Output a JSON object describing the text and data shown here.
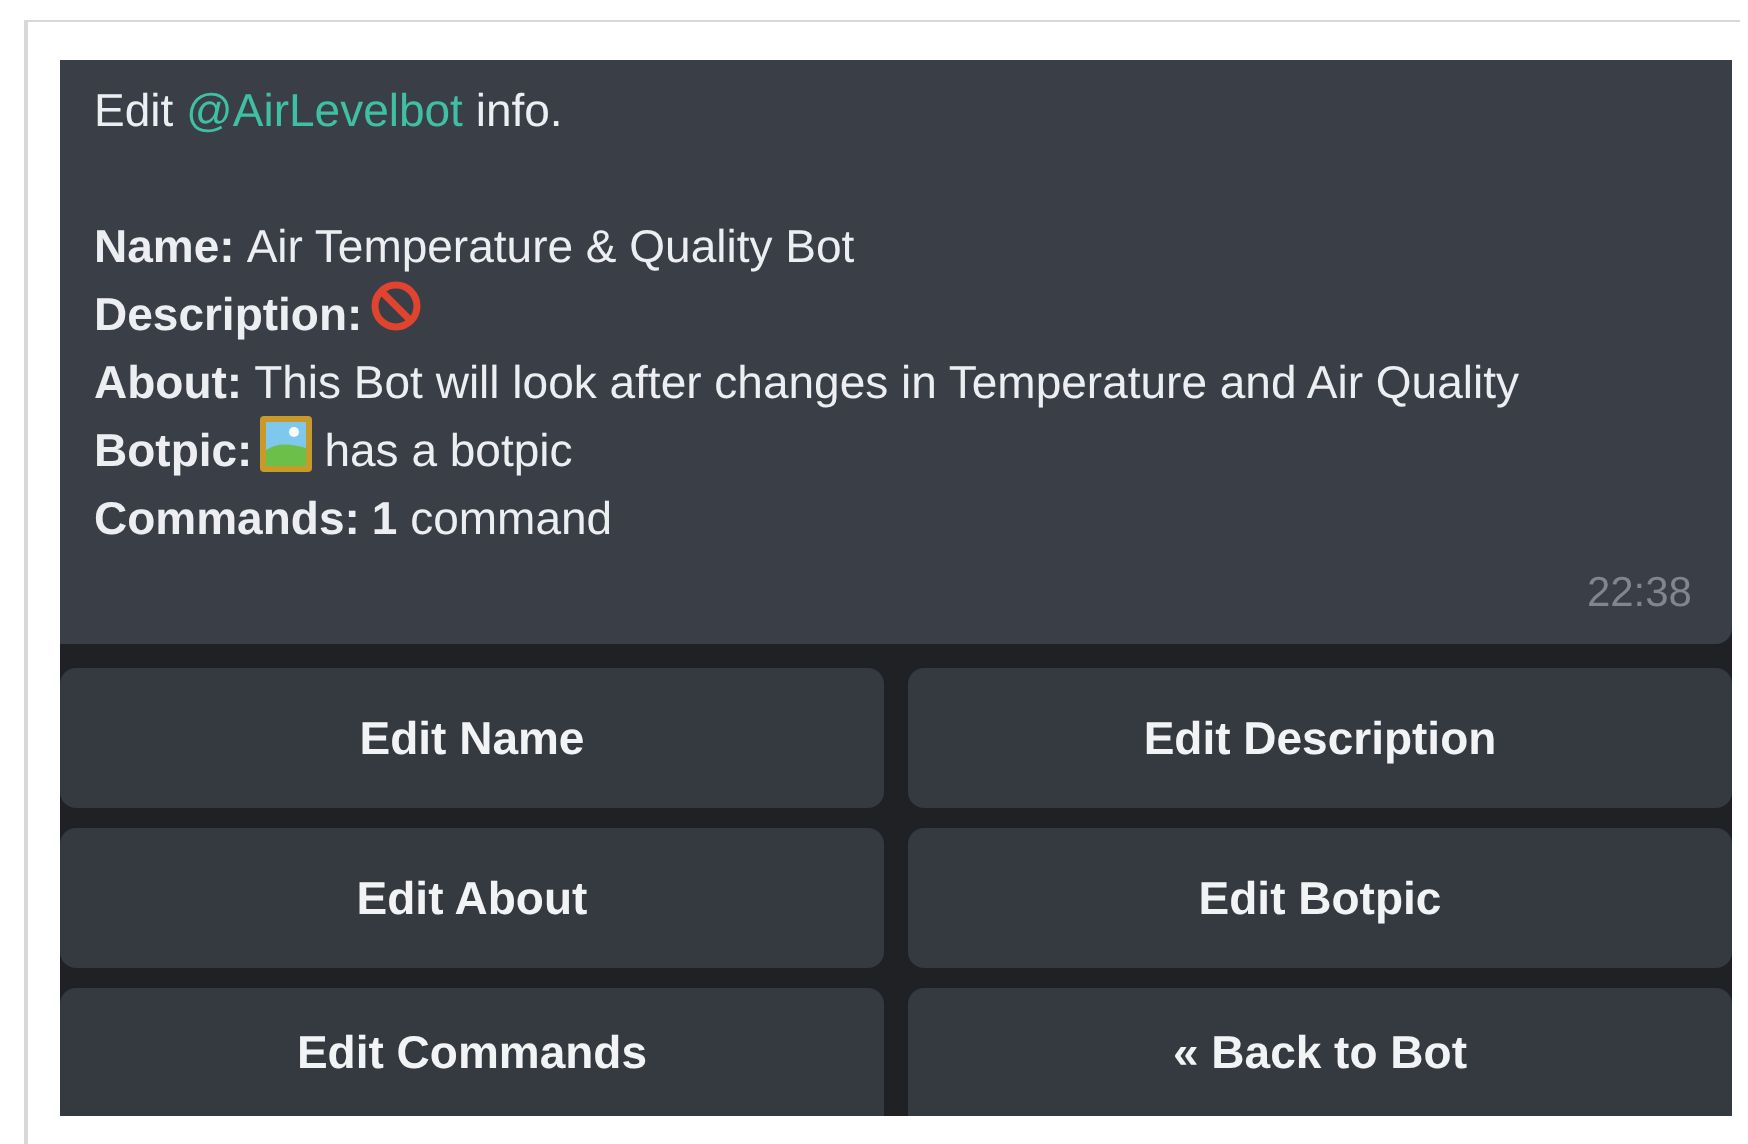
{
  "message": {
    "intro": {
      "before": "Edit ",
      "mention": "@AirLevelbot",
      "after": " info."
    },
    "fields": [
      {
        "label": "Name:",
        "kind": "text",
        "value": "Air Temperature & Quality Bot"
      },
      {
        "label": "Description:",
        "kind": "no-entry"
      },
      {
        "label": "About:",
        "kind": "text",
        "value": "This Bot will look after changes in Temperature and Air Quality"
      },
      {
        "label": "Botpic:",
        "kind": "picture",
        "value": "has a botpic"
      },
      {
        "label": "Commands:",
        "kind": "text",
        "value": "**1** command"
      }
    ],
    "time": "22:38"
  },
  "keyboard": [
    [
      "Edit Name",
      "Edit Description"
    ],
    [
      "Edit About",
      "Edit Botpic"
    ],
    [
      "Edit Commands",
      "« Back to Bot"
    ]
  ]
}
